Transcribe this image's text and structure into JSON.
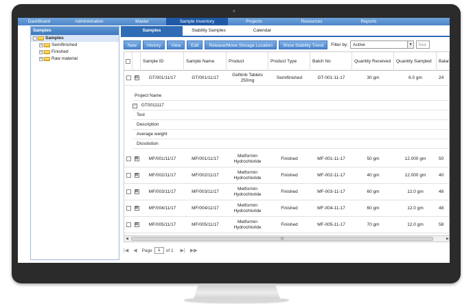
{
  "nav": {
    "items": [
      "DashBoard",
      "Administration",
      "Master",
      "Sample Inventory",
      "Projects",
      "Resources",
      "Reports"
    ],
    "active": "Sample Inventory"
  },
  "left_panel": {
    "title": "Samples",
    "tree": {
      "root": "Samples",
      "children": [
        "Semifinished",
        "Finished",
        "Raw material"
      ]
    }
  },
  "tabs": [
    "Samples",
    "Stability Samples",
    "Calendar"
  ],
  "toolbar": {
    "buttons": [
      "New",
      "History",
      "View",
      "Edit",
      "Release/Move Storage Location",
      "Show Stability Trend"
    ],
    "filter_label": "Filter by:",
    "filter_value": "Active",
    "search_placeholder": "Sea"
  },
  "grid": {
    "columns": [
      "Sample ID",
      "Sample Name",
      "Product",
      "Product Type",
      "Batch No",
      "Quantity Received",
      "Quantity Sampled",
      "Balan"
    ],
    "rows": [
      {
        "expander": "⊟",
        "sample_id": "GT/001/11/17",
        "sample_name": "GT/001/11/17",
        "product": "Gefitinb Tablets 250mg",
        "product_type": "Semifinished",
        "batch_no": "GT-001-11-17",
        "qty_received": "30 gm",
        "qty_sampled": "6.0 gm",
        "balance": "24"
      },
      {
        "expander": "⊞",
        "sample_id": "MF/001/11/17",
        "sample_name": "MF/001/11/17",
        "product": "Metformin Hydrochloride",
        "product_type": "Finished",
        "batch_no": "MF-001-11-17",
        "qty_received": "50 gm",
        "qty_sampled": "12.000 gm",
        "balance": "50"
      },
      {
        "expander": "⊞",
        "sample_id": "MF/002/11/17",
        "sample_name": "MF/002/11/17",
        "product": "Metformin Hydrochloride",
        "product_type": "Finished",
        "batch_no": "MF-002-11-17",
        "qty_received": "40 gm",
        "qty_sampled": "12.000 gm",
        "balance": "40"
      },
      {
        "expander": "⊞",
        "sample_id": "MF/003/11/17",
        "sample_name": "MF/003/11/17",
        "product": "Metformin Hydrochloride",
        "product_type": "Finished",
        "batch_no": "MF-003-11-17",
        "qty_received": "60 gm",
        "qty_sampled": "12.0 gm",
        "balance": "48"
      },
      {
        "expander": "⊞",
        "sample_id": "MF/004/11/17",
        "sample_name": "MF/004/11/17",
        "product": "Metformin Hydrochloride",
        "product_type": "Finished",
        "batch_no": "MF-004-11-17",
        "qty_received": "60 gm",
        "qty_sampled": "12.0 gm",
        "balance": "48"
      },
      {
        "expander": "⊞",
        "sample_id": "MF/005/11/17",
        "sample_name": "MF/005/11/17",
        "product": "Metformin Hydrochloride",
        "product_type": "Finished",
        "batch_no": "MF-005-11-17",
        "qty_received": "70 gm",
        "qty_sampled": "12.0 gm",
        "balance": "58"
      }
    ],
    "detail": {
      "header": "Project Name",
      "project": "GT0011117",
      "test_header": "Test",
      "tests": [
        "Description",
        "Average weight",
        "Dissolution"
      ]
    }
  },
  "pager": {
    "label": "Page",
    "current": "1",
    "of_text": "of 1"
  },
  "colors": {
    "accent": "#2f6cb5",
    "nav_active": "#1e5aa8",
    "button": "#4a86cd"
  }
}
